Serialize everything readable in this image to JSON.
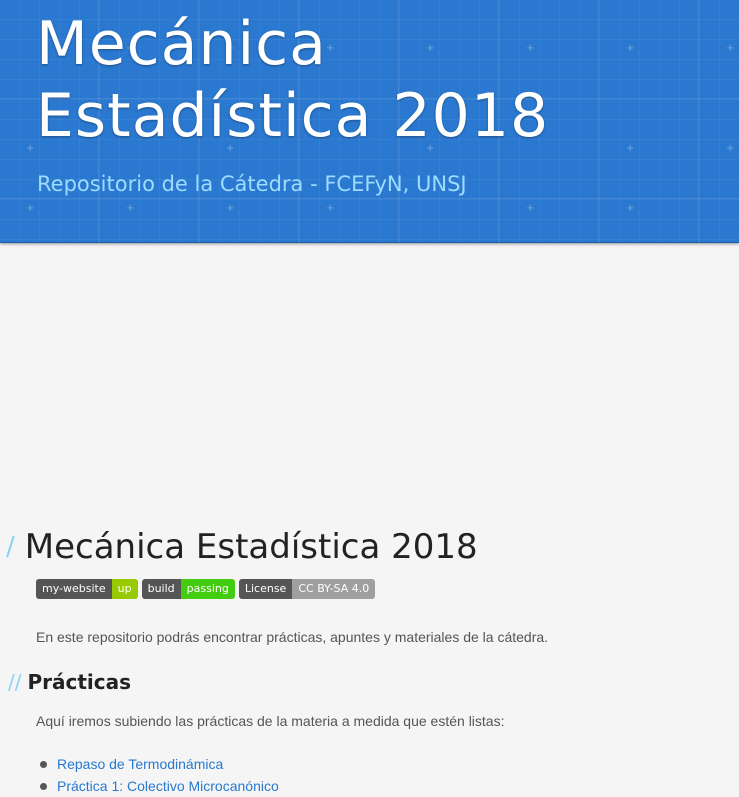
{
  "header": {
    "title_line1": "Mecánica",
    "title_line2": "Estadística 2018",
    "subtitle": "Repositorio de la Cátedra - FCEFyN, UNSJ"
  },
  "main": {
    "page_title": "Mecánica Estadística 2018",
    "title_slash": "/",
    "badges": [
      {
        "label": "my-website",
        "value": "up",
        "color": "#97ca00"
      },
      {
        "label": "build",
        "value": "passing",
        "color": "#4c1"
      },
      {
        "label": "License",
        "value": "CC BY-SA 4.0",
        "color": "#9f9f9f"
      }
    ],
    "intro": "En este repositorio podrás encontrar prácticas, apuntes y materiales de la cátedra.",
    "section": {
      "slash": "//",
      "title": "Prácticas",
      "text": "Aquí iremos subiendo las prácticas de la materia a medida que estén listas:",
      "links": [
        "Repaso de Termodinámica",
        "Práctica 1: Colectivo Microcanónico"
      ]
    }
  },
  "colors": {
    "header_bg": "#2a78cf",
    "subtitle": "#9ddcff",
    "link": "#2879d0",
    "slash": "#8ad3f7"
  }
}
